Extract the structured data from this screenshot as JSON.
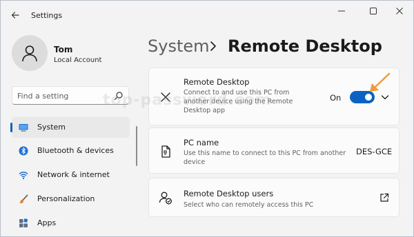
{
  "window": {
    "title": "Settings",
    "accent": "#0a63c2"
  },
  "user": {
    "name": "Tom",
    "account_type": "Local Account"
  },
  "search": {
    "placeholder": "Find a setting",
    "value": ""
  },
  "sidebar": {
    "items": [
      {
        "label": "System",
        "icon": "monitor-icon",
        "active": true
      },
      {
        "label": "Bluetooth & devices",
        "icon": "bluetooth-icon",
        "active": false
      },
      {
        "label": "Network & internet",
        "icon": "wifi-icon",
        "active": false
      },
      {
        "label": "Personalization",
        "icon": "brush-icon",
        "active": false
      },
      {
        "label": "Apps",
        "icon": "apps-icon",
        "active": false
      }
    ]
  },
  "breadcrumb": {
    "parent": "System",
    "current": "Remote Desktop"
  },
  "cards": {
    "remote_desktop": {
      "title": "Remote Desktop",
      "description": "Connect to and use this PC from another device using the Remote Desktop app",
      "toggle_label": "On",
      "toggle_on": true,
      "icon": "remote-desktop-icon"
    },
    "pc_name": {
      "title": "PC name",
      "description": "Use this name to connect to this PC from another device",
      "value": "DES-GCE",
      "icon": "pc-name-icon"
    },
    "users": {
      "title": "Remote Desktop users",
      "description": "Select who can remotely access this PC",
      "icon": "users-icon"
    }
  },
  "annotation": {
    "arrow_color": "#f29b38"
  },
  "watermark": "top-password.com"
}
